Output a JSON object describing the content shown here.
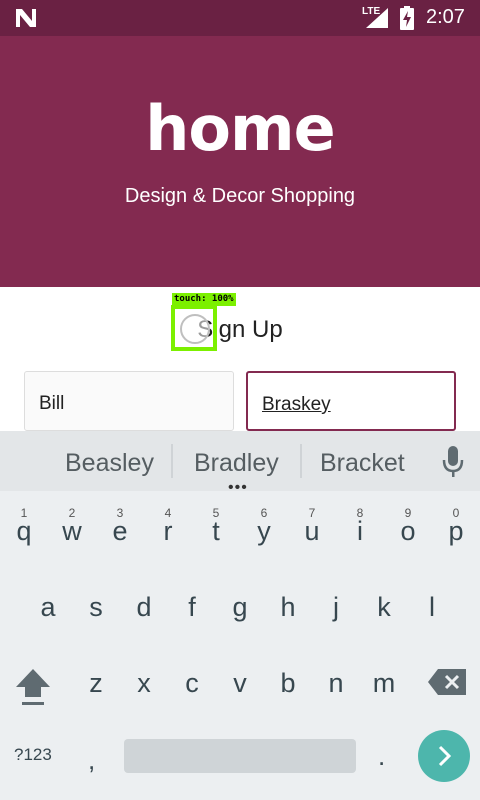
{
  "status_bar": {
    "network": "LTE",
    "time": "2:07"
  },
  "hero": {
    "logo_text": "home",
    "tagline": "Design & Decor Shopping"
  },
  "touch_overlay": {
    "label": "touch: 100%"
  },
  "signup": {
    "title": "Sign Up",
    "first_name_value": "Bill",
    "last_name_value": "Braskey"
  },
  "keyboard": {
    "suggestions": [
      "Beasley",
      "Bradley",
      "Bracket"
    ],
    "row1": [
      {
        "key": "q",
        "hint": "1"
      },
      {
        "key": "w",
        "hint": "2"
      },
      {
        "key": "e",
        "hint": "3"
      },
      {
        "key": "r",
        "hint": "4"
      },
      {
        "key": "t",
        "hint": "5"
      },
      {
        "key": "y",
        "hint": "6"
      },
      {
        "key": "u",
        "hint": "7"
      },
      {
        "key": "i",
        "hint": "8"
      },
      {
        "key": "o",
        "hint": "9"
      },
      {
        "key": "p",
        "hint": "0"
      }
    ],
    "row2": [
      "a",
      "s",
      "d",
      "f",
      "g",
      "h",
      "j",
      "k",
      "l"
    ],
    "row3": [
      "z",
      "x",
      "c",
      "v",
      "b",
      "n",
      "m"
    ],
    "symbols_label": "?123",
    "comma": ",",
    "period": ".",
    "accent_color": "#4db6ac"
  },
  "colors": {
    "brand": "#832a50",
    "status_bar": "#6a2143"
  }
}
